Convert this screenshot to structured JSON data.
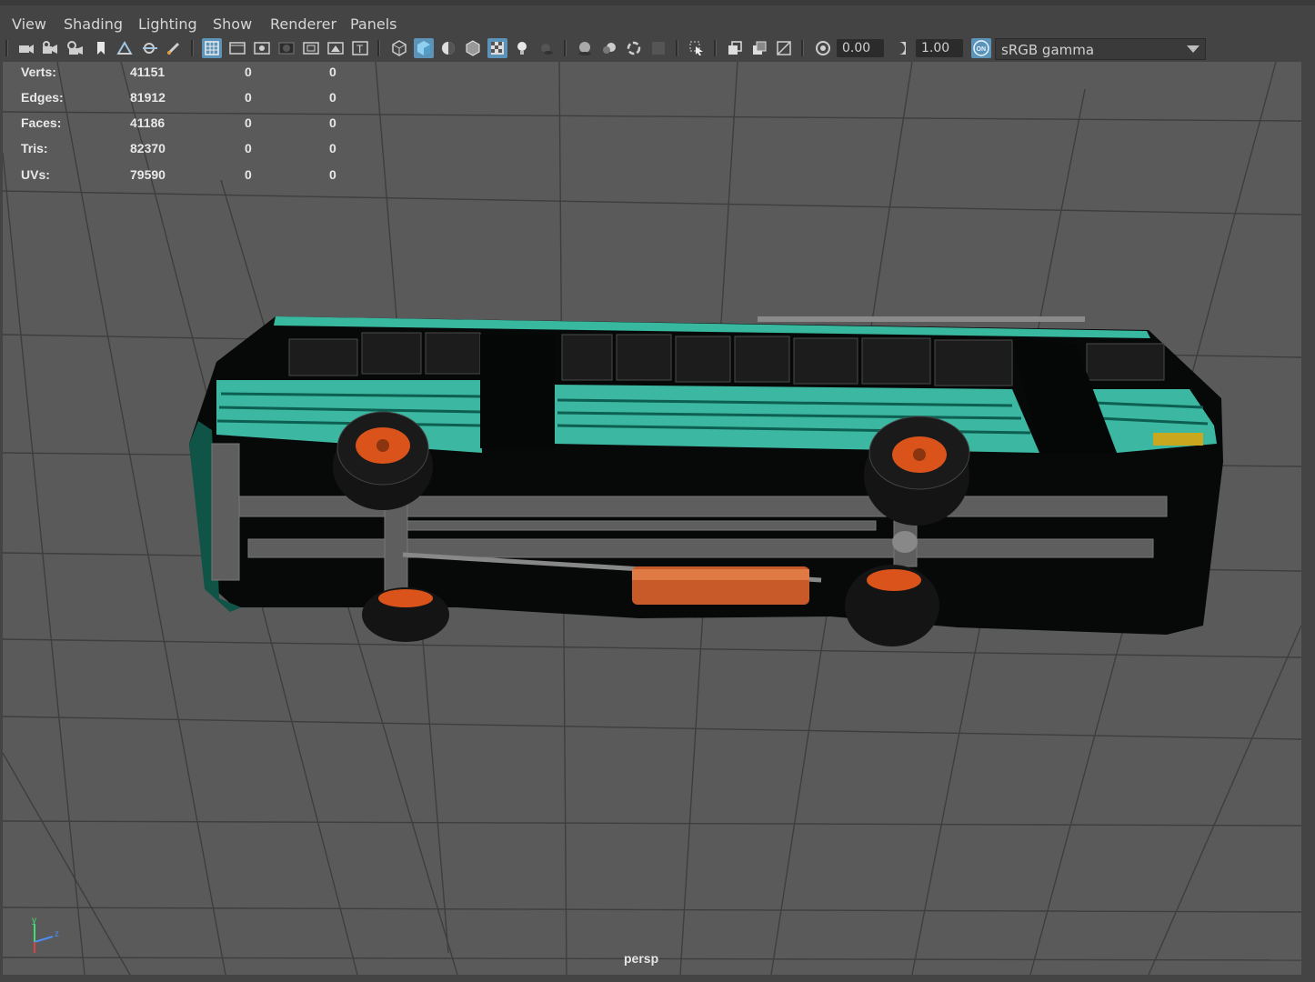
{
  "menu": {
    "items": [
      {
        "label": "View"
      },
      {
        "label": "Shading"
      },
      {
        "label": "Lighting"
      },
      {
        "label": "Show"
      },
      {
        "label": "Renderer"
      },
      {
        "label": "Panels"
      }
    ]
  },
  "toolbar": {
    "exposure_value": "0.00",
    "gamma_value": "1.00",
    "color_management_badge": "ON",
    "color_space": "sRGB gamma",
    "icons": [
      "camera-select-icon",
      "camera-lock-icon",
      "camera-attributes-icon",
      "bookmark-icon",
      "image-plane-icon",
      "2d-pan-zoom-icon",
      "grease-pencil-icon",
      "grid-icon",
      "film-gate-icon",
      "resolution-gate-icon",
      "gate-mask-icon",
      "field-chart-icon",
      "safe-action-icon",
      "safe-title-icon",
      "wireframe-icon",
      "smooth-shade-icon",
      "default-material-icon",
      "wireframe-on-shaded-icon",
      "xray-icon",
      "use-all-lights-icon",
      "shadows-icon",
      "screen-space-ao-icon",
      "motion-blur-icon",
      "anti-aliasing-icon",
      "depth-of-field-icon",
      "isolate-select-icon",
      "xray-joints-icon",
      "xray-active-icon",
      "backface-culling-icon",
      "exposure-icon",
      "gamma-icon"
    ]
  },
  "hud": {
    "rows": [
      {
        "label": "Verts:",
        "total": "41151",
        "selected": "0",
        "components": "0"
      },
      {
        "label": "Edges:",
        "total": "81912",
        "selected": "0",
        "components": "0"
      },
      {
        "label": "Faces:",
        "total": "41186",
        "selected": "0",
        "components": "0"
      },
      {
        "label": "Tris:",
        "total": "82370",
        "selected": "0",
        "components": "0"
      },
      {
        "label": "UVs:",
        "total": "79590",
        "selected": "0",
        "components": "0"
      }
    ]
  },
  "viewport": {
    "camera_label": "persp",
    "axis_labels": {
      "y": "y",
      "z": "z"
    },
    "colors": {
      "background": "#5a5a5a",
      "grid": "#3c3c3c",
      "bus_teal": "#3fb8a0",
      "bus_body": "#080a0a",
      "chassis": "#5b5b5b",
      "hub": "#d9531b",
      "fuel_tank": "#c85a2a"
    }
  }
}
